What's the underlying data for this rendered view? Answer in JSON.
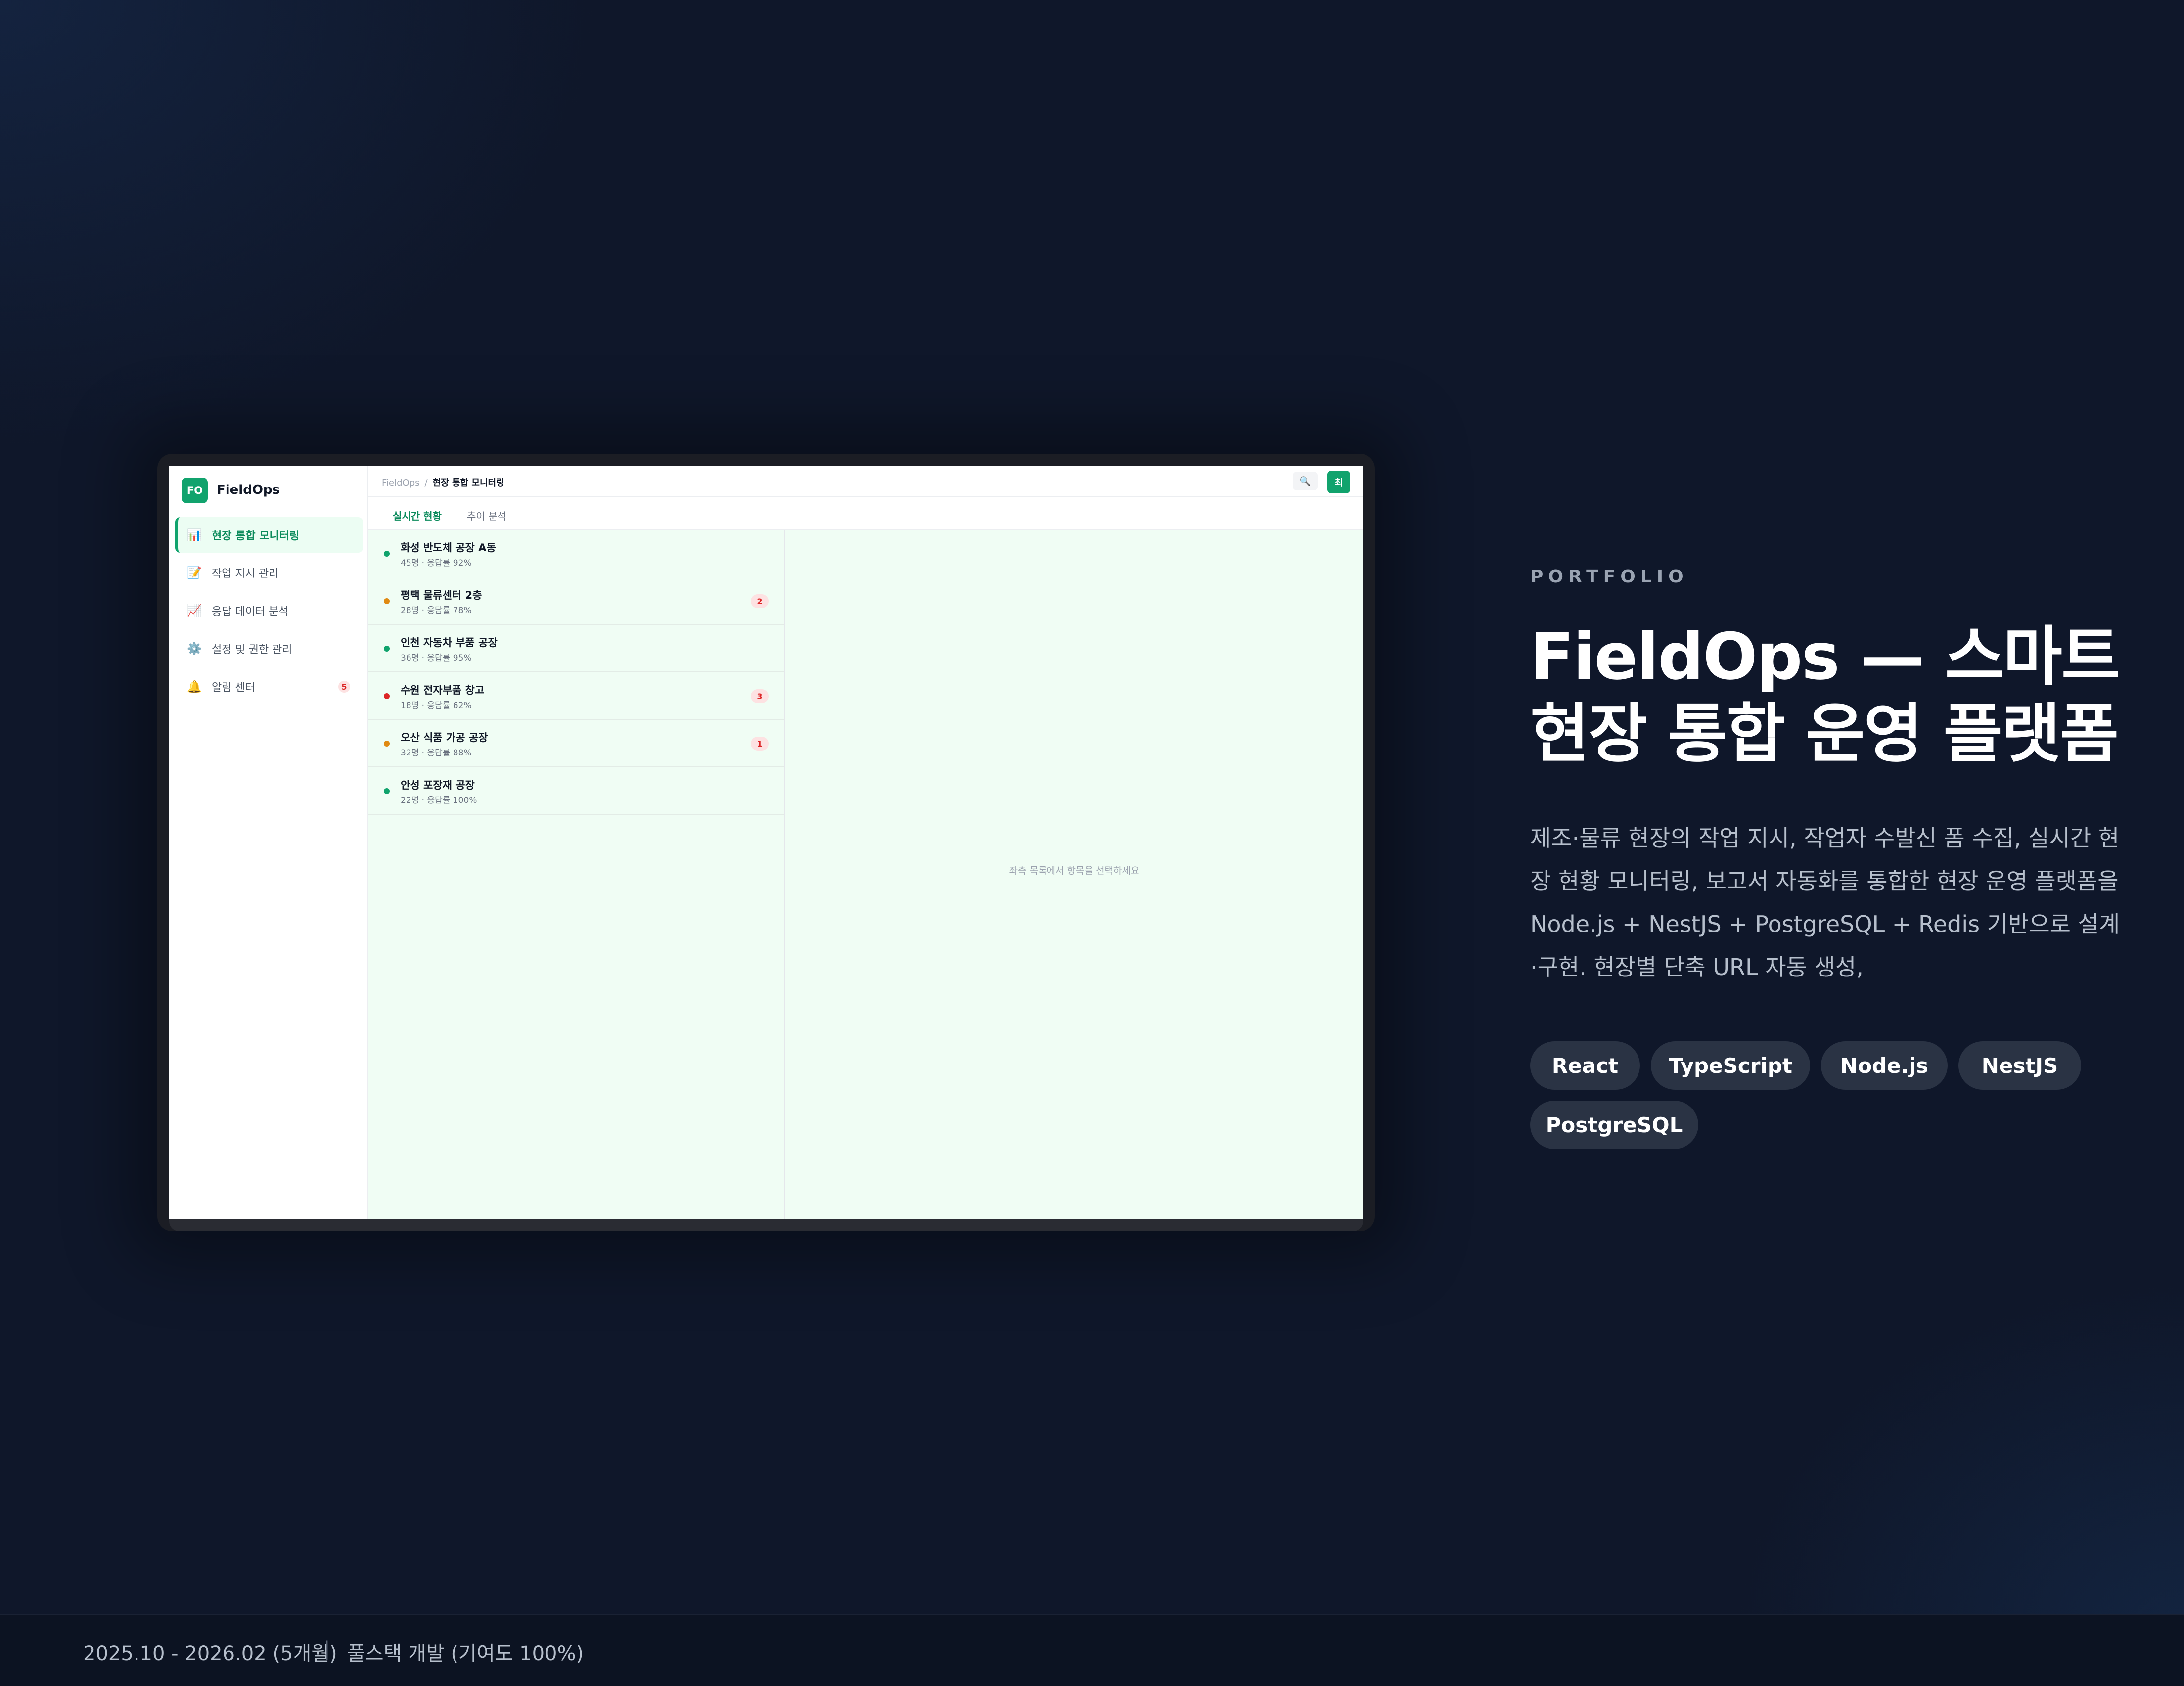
{
  "app": {
    "logo_abbr": "FO",
    "logo_name": "FieldOps",
    "nav": [
      {
        "icon": "📊",
        "label": "현장 통합 모니터링",
        "active": true,
        "badge": null
      },
      {
        "icon": "📝",
        "label": "작업 지시 관리",
        "active": false,
        "badge": null
      },
      {
        "icon": "📈",
        "label": "응답 데이터 분석",
        "active": false,
        "badge": null
      },
      {
        "icon": "⚙️",
        "label": "설정 및 권한 관리",
        "active": false,
        "badge": null
      },
      {
        "icon": "🔔",
        "label": "알림 센터",
        "active": false,
        "badge": "5"
      }
    ],
    "breadcrumb": {
      "root": "FieldOps",
      "sep": "/",
      "current": "현장 통합 모니터링"
    },
    "search_icon_glyph": "🔍",
    "avatar_initial": "최",
    "tabs": [
      {
        "label": "실시간 현황",
        "active": true
      },
      {
        "label": "추이 분석",
        "active": false
      }
    ],
    "sites": [
      {
        "name": "화성 반도체 공장 A동",
        "meta": "45명 · 응답률 92%",
        "status_color": "#10a36c",
        "count": null
      },
      {
        "name": "평택 물류센터 2층",
        "meta": "28명 · 응답률 78%",
        "status_color": "#e08a12",
        "count": "2"
      },
      {
        "name": "인천 자동차 부품 공장",
        "meta": "36명 · 응답률 95%",
        "status_color": "#10a36c",
        "count": null
      },
      {
        "name": "수원 전자부품 창고",
        "meta": "18명 · 응답률 62%",
        "status_color": "#dc2626",
        "count": "3"
      },
      {
        "name": "오산 식품 가공 공장",
        "meta": "32명 · 응답률 88%",
        "status_color": "#e08a12",
        "count": "1"
      },
      {
        "name": "안성 포장재 공장",
        "meta": "22명 · 응답률 100%",
        "status_color": "#10a36c",
        "count": null
      }
    ],
    "empty_message": "좌측 목록에서 항목을 선택하세요"
  },
  "portfolio": {
    "eyebrow": "PORTFOLIO",
    "title_line1": "FieldOps — 스마트",
    "title_line2": "현장 통합 운영 플랫폼",
    "description": "제조·물류 현장의 작업 지시, 작업자 수발신 폼 수집, 실시간 현장 현황 모니터링, 보고서 자동화를 통합한 현장 운영 플랫폼을 Node.js + NestJS + PostgreSQL + Redis 기반으로 설계·구현. 현장별 단축 URL 자동 생성,",
    "tags": [
      "React",
      "TypeScript",
      "Node.js",
      "NestJS",
      "PostgreSQL"
    ]
  },
  "footer": {
    "period": "2025.10 - 2026.02 (5개월)",
    "divider": "|",
    "role": "풀스택 개발 (기여도 100%)"
  },
  "colors": {
    "accent": "#11a36d",
    "background": "#0f172a",
    "tag_bg": "#2a3344"
  }
}
